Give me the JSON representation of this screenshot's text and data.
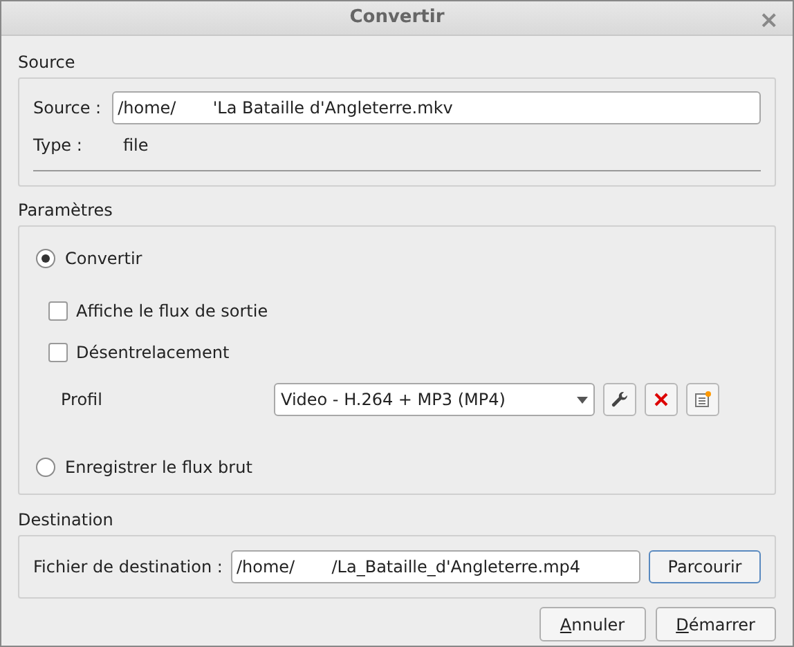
{
  "window": {
    "title": "Convertir",
    "close": "×"
  },
  "source": {
    "heading": "Source",
    "label": "Source :",
    "value": "/home/       'La Bataille d'Angleterre.mkv",
    "type_label": "Type :",
    "type_value": "file"
  },
  "parameters": {
    "heading": "Paramètres",
    "modes": [
      {
        "label": "Convertir",
        "selected": true
      },
      {
        "label": "Enregistrer le flux brut",
        "selected": false
      }
    ],
    "options": [
      {
        "label": "Affiche le flux de sortie",
        "checked": false
      },
      {
        "label": "Désentrelacement",
        "checked": false
      }
    ],
    "profile_label": "Profil",
    "profile_value": "Video - H.264 + MP3 (MP4)"
  },
  "destination": {
    "heading": "Destination",
    "label": "Fichier de destination :",
    "value": "/home/       /La_Bataille_d'Angleterre.mp4",
    "browse": "Parcourir"
  },
  "buttons": [
    {
      "mnemonic": "A",
      "rest": "nnuler",
      "default": false
    },
    {
      "mnemonic": "D",
      "rest": "émarrer",
      "default": false
    }
  ]
}
